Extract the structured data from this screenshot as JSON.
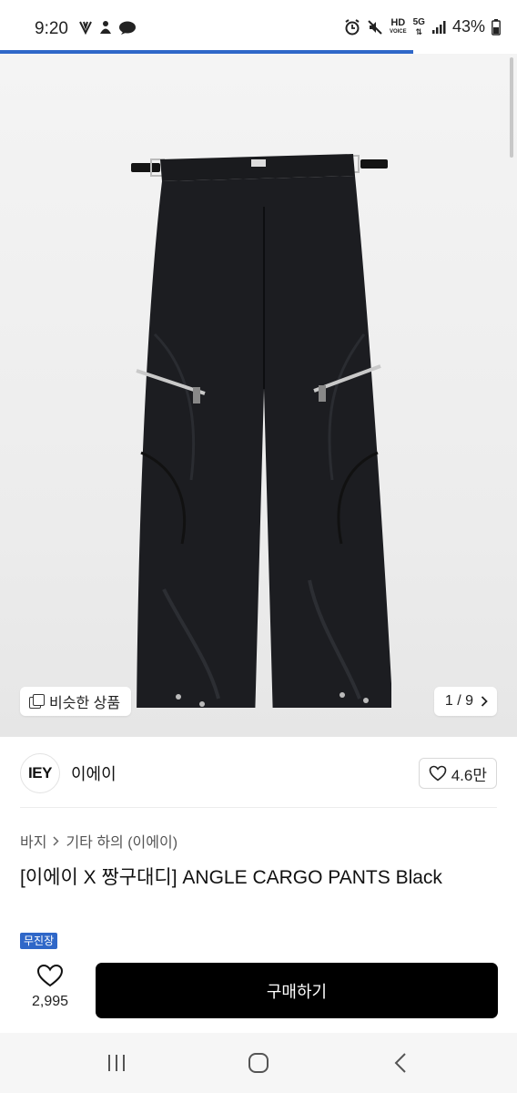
{
  "status_bar": {
    "time": "9:20",
    "left_icons": [
      "download-icon",
      "person-icon",
      "chat-icon"
    ],
    "hd_label": "HD",
    "voice_label": "VOICE",
    "network_label": "5G",
    "battery_percent": "43%"
  },
  "page_progress": 0.8,
  "hero": {
    "similar_label": "비슷한 상품",
    "page_indicator": "1 / 9"
  },
  "brand": {
    "logo_text": "IEY",
    "name": "이에이",
    "like_count": "4.6만"
  },
  "breadcrumb": {
    "category": "바지",
    "subcategory": "기타 하의 (이에이)"
  },
  "product": {
    "title": "[이에이 X 짱구대디] ANGLE CARGO PANTS Black",
    "badge": "무진장"
  },
  "bottom": {
    "wish_count": "2,995",
    "buy_label": "구매하기"
  },
  "colors": {
    "accent": "#2f67c8",
    "buy_button": "#000000"
  }
}
